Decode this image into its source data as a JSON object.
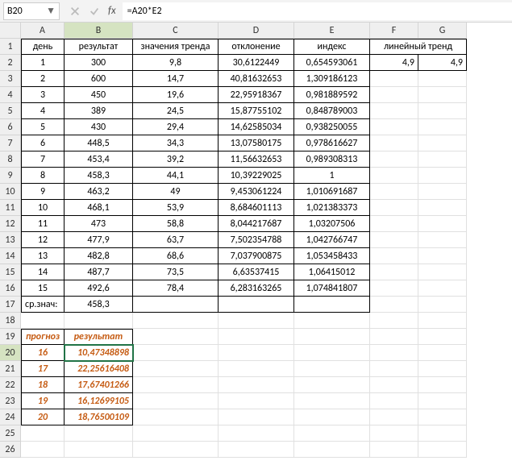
{
  "formula_bar": {
    "cell_ref": "B20",
    "formula": "=A20*E2"
  },
  "columns": [
    "A",
    "B",
    "C",
    "D",
    "E",
    "F",
    "G"
  ],
  "row_numbers": [
    "1",
    "2",
    "3",
    "4",
    "5",
    "6",
    "7",
    "8",
    "9",
    "10",
    "11",
    "12",
    "13",
    "14",
    "15",
    "16",
    "17",
    "18",
    "19",
    "20",
    "21",
    "22",
    "23",
    "24",
    "25",
    "26"
  ],
  "headers": {
    "A": "день",
    "B": "результат",
    "C": "значения тренда",
    "D": "отклонение",
    "E": "индекс",
    "FG": "линейный тренд"
  },
  "data": [
    {
      "A": "1",
      "B": "300",
      "C": "9,8",
      "D": "30,6122449",
      "E": "0,654593061",
      "F": "4,9",
      "G": "4,9"
    },
    {
      "A": "2",
      "B": "600",
      "C": "14,7",
      "D": "40,81632653",
      "E": "1,309186123"
    },
    {
      "A": "3",
      "B": "450",
      "C": "19,6",
      "D": "22,95918367",
      "E": "0,981889592"
    },
    {
      "A": "4",
      "B": "389",
      "C": "24,5",
      "D": "15,87755102",
      "E": "0,848789003"
    },
    {
      "A": "5",
      "B": "430",
      "C": "29,4",
      "D": "14,62585034",
      "E": "0,938250055"
    },
    {
      "A": "6",
      "B": "448,5",
      "C": "34,3",
      "D": "13,07580175",
      "E": "0,978616627"
    },
    {
      "A": "7",
      "B": "453,4",
      "C": "39,2",
      "D": "11,56632653",
      "E": "0,989308313"
    },
    {
      "A": "8",
      "B": "458,3",
      "C": "44,1",
      "D": "10,39229025",
      "E": "1"
    },
    {
      "A": "9",
      "B": "463,2",
      "C": "49",
      "D": "9,453061224",
      "E": "1,010691687"
    },
    {
      "A": "10",
      "B": "468,1",
      "C": "53,9",
      "D": "8,684601113",
      "E": "1,021383373"
    },
    {
      "A": "11",
      "B": "473",
      "C": "58,8",
      "D": "8,044217687",
      "E": "1,03207506"
    },
    {
      "A": "12",
      "B": "477,9",
      "C": "63,7",
      "D": "7,502354788",
      "E": "1,042766747"
    },
    {
      "A": "13",
      "B": "482,8",
      "C": "68,6",
      "D": "7,037900875",
      "E": "1,053458433"
    },
    {
      "A": "14",
      "B": "487,7",
      "C": "73,5",
      "D": "6,63537415",
      "E": "1,06415012"
    },
    {
      "A": "15",
      "B": "492,6",
      "C": "78,4",
      "D": "6,283163265",
      "E": "1,074841807"
    }
  ],
  "summary": {
    "A": "ср.знач:",
    "B": "458,3"
  },
  "forecast_header": {
    "A": "прогноз",
    "B": "результат"
  },
  "forecast": [
    {
      "A": "16",
      "B": "10,47348898"
    },
    {
      "A": "17",
      "B": "22,25616408"
    },
    {
      "A": "18",
      "B": "17,67401266"
    },
    {
      "A": "19",
      "B": "16,12699105"
    },
    {
      "A": "20",
      "B": "18,76500109"
    }
  ],
  "icon_names": {
    "cancel": "cancel-icon",
    "accept": "accept-icon",
    "fx": "fx-icon",
    "dropdown": "dropdown-icon"
  }
}
